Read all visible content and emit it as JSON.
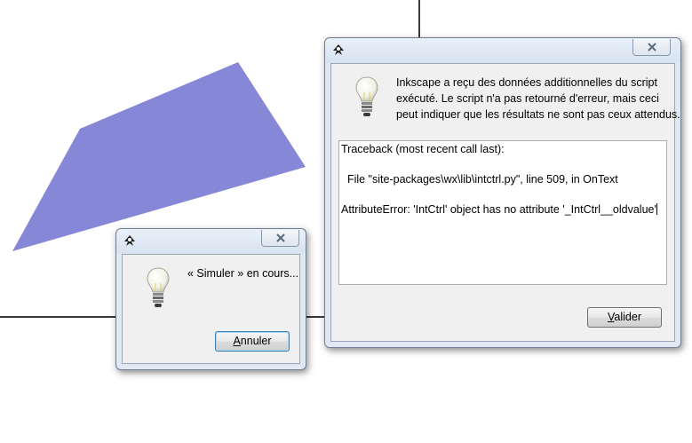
{
  "background": {
    "shape_color": "#8787d7",
    "line_color": "#3a3a3a"
  },
  "main_dialog": {
    "icon": "inkscape-icon",
    "close_icon": "close-x-icon",
    "message_lines": [
      "Inkscape a reçu des données additionnelles du script",
      "exécuté. Le script n'a pas retourné d'erreur, mais ceci",
      "peut indiquer que les résultats ne sont pas ceux attendus."
    ],
    "traceback_lines": [
      "Traceback (most recent call last):",
      "",
      "  File \"site-packages\\wx\\lib\\intctrl.py\", line 509, in OnText",
      "",
      "AttributeError: 'IntCtrl' object has no attribute '_IntCtrl__oldvalue'"
    ],
    "ok_button": {
      "mnemonic": "V",
      "rest": "alider"
    }
  },
  "progress_dialog": {
    "icon": "inkscape-icon",
    "close_icon": "close-x-icon",
    "message": "« Simuler » en cours...",
    "cancel_button": {
      "mnemonic": "A",
      "rest": "nnuler"
    }
  }
}
